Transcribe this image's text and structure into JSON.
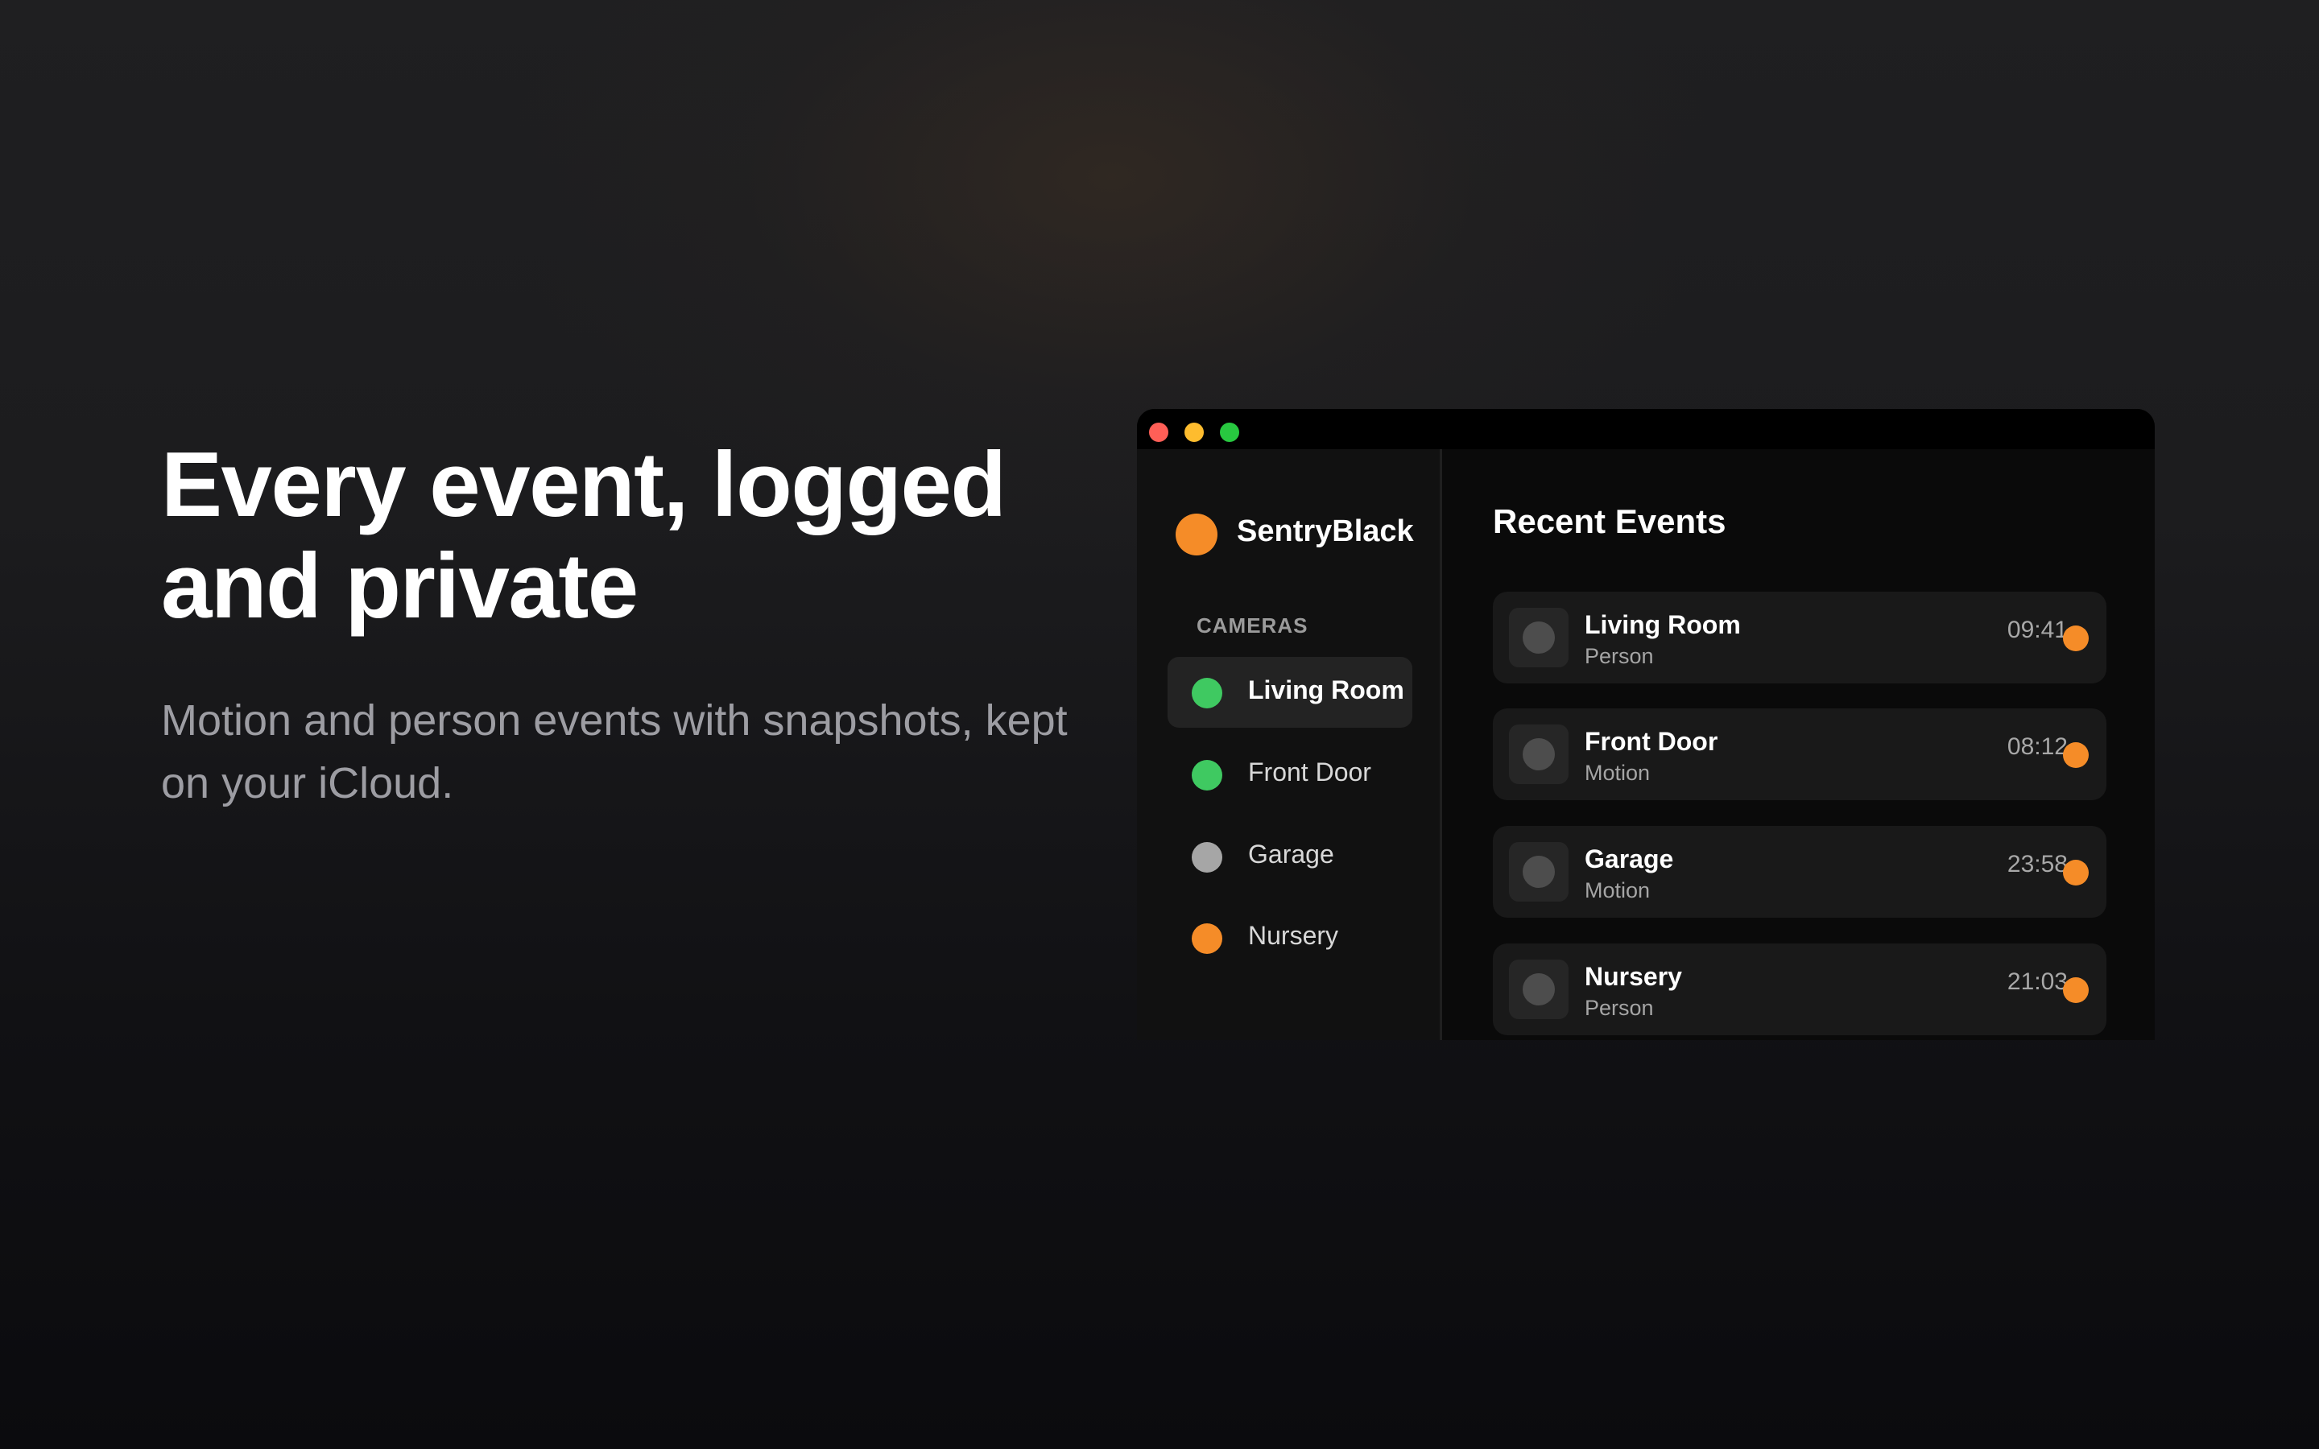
{
  "hero": {
    "headline": "Every event, logged and private",
    "subhead": "Motion and person events with snapshots, kept on your iCloud."
  },
  "app": {
    "brand": "SentryBlack",
    "brand_color": "#f58c28",
    "sidebar": {
      "section_label": "CAMERAS",
      "cameras": [
        {
          "label": "Living Room",
          "status_color": "#3fc961",
          "selected": true
        },
        {
          "label": "Front Door",
          "status_color": "#3fc961",
          "selected": false
        },
        {
          "label": "Garage",
          "status_color": "#a6a6a6",
          "selected": false
        },
        {
          "label": "Nursery",
          "status_color": "#f58c28",
          "selected": false
        }
      ]
    },
    "main": {
      "title": "Recent Events",
      "events": [
        {
          "camera": "Living Room",
          "type": "Person",
          "time": "09:41",
          "indicator_color": "#f58c28"
        },
        {
          "camera": "Front Door",
          "type": "Motion",
          "time": "08:12",
          "indicator_color": "#f58c28"
        },
        {
          "camera": "Garage",
          "type": "Motion",
          "time": "23:58",
          "indicator_color": "#f58c28"
        },
        {
          "camera": "Nursery",
          "type": "Person",
          "time": "21:03",
          "indicator_color": "#f58c28"
        }
      ]
    },
    "window_controls": {
      "close_color": "#ff5f57",
      "minimize_color": "#febc2e",
      "zoom_color": "#28c840"
    }
  }
}
